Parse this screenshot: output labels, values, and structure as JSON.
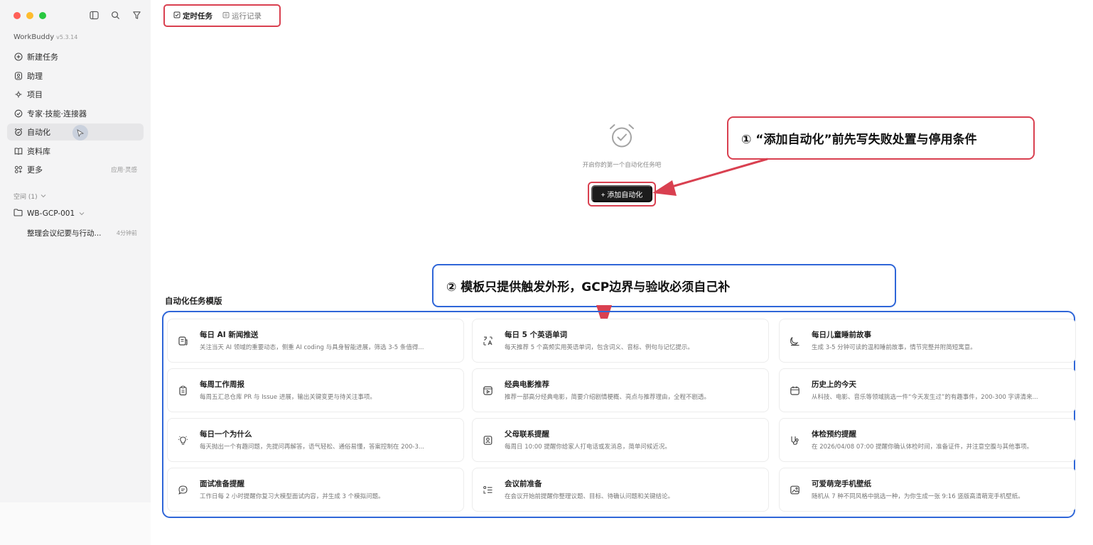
{
  "sidebar": {
    "app_name": "WorkBuddy",
    "version": "v5.3.14",
    "nav": [
      {
        "label": "新建任务",
        "icon": "plus-circle-icon"
      },
      {
        "label": "助理",
        "icon": "assistant-icon"
      },
      {
        "label": "项目",
        "icon": "project-icon"
      },
      {
        "label": "专家·技能·连接器",
        "icon": "expert-icon"
      },
      {
        "label": "自动化",
        "icon": "alarm-clock-icon",
        "active": true
      },
      {
        "label": "资料库",
        "icon": "book-icon"
      },
      {
        "label": "更多",
        "icon": "grid-icon",
        "right": "应用·灵感"
      }
    ],
    "space_label": "空间 (1)",
    "workspace": "WB-GCP-001",
    "task": {
      "label": "整理会议纪要与行动...",
      "time": "4分钟前"
    }
  },
  "tabs": [
    {
      "label": "定时任务",
      "icon": "checkbox-icon",
      "active": true
    },
    {
      "label": "运行记录",
      "icon": "history-icon",
      "active": false
    }
  ],
  "empty": {
    "text": "开启你的第一个自动化任务吧",
    "button": "+ 添加自动化"
  },
  "callouts": {
    "one": "① “添加自动化”前先写失败处置与停用条件",
    "two": "② 模板只提供触发外形，GCP边界与验收必须自己补"
  },
  "templates": {
    "title": "自动化任务模版",
    "items": [
      {
        "title": "每日 AI 新闻推送",
        "desc": "关注当天 AI 领域的重要动态，侧重 AI coding 与具身智能进展，筛选 3-5 条值得...",
        "icon": "news-icon"
      },
      {
        "title": "每日 5 个英语单词",
        "desc": "每天推荐 5 个高频实用英语单词，包含词义、音标、例句与记忆提示。",
        "icon": "translate-icon"
      },
      {
        "title": "每日儿童睡前故事",
        "desc": "生成 3-5 分钟可读的温和睡前故事，情节完整并附简短寓意。",
        "icon": "moon-icon"
      },
      {
        "title": "每周工作周报",
        "desc": "每周五汇总仓库 PR 与 Issue 进展，输出关键变更与待关注事项。",
        "icon": "clipboard-icon"
      },
      {
        "title": "经典电影推荐",
        "desc": "推荐一部高分经典电影，简要介绍剧情梗概、亮点与推荐理由，全程不剧透。",
        "icon": "film-icon"
      },
      {
        "title": "历史上的今天",
        "desc": "从科技、电影、音乐等领域挑选一件“今天发生过”的有趣事件，200-300 字讲清来...",
        "icon": "calendar-icon"
      },
      {
        "title": "每日一个为什么",
        "desc": "每天抛出一个有趣问题，先提问再解答，语气轻松、通俗易懂，答案控制在 200-3...",
        "icon": "bulb-icon"
      },
      {
        "title": "父母联系提醒",
        "desc": "每周日 10:00 提醒你给家人打电话或发消息，简单问候近况。",
        "icon": "contact-icon"
      },
      {
        "title": "体检预约提醒",
        "desc": "在 2026/04/08 07:00 提醒你确认体检时间，准备证件，并注意空腹与其他事项。",
        "icon": "health-icon"
      },
      {
        "title": "面试准备提醒",
        "desc": "工作日每 2 小时提醒你复习大模型面试内容，并生成 3 个模拟问题。",
        "icon": "chat-icon"
      },
      {
        "title": "会议前准备",
        "desc": "在会议开始前提醒你整理议题、目标、待确认问题和关键结论。",
        "icon": "list-icon"
      },
      {
        "title": "可爱萌宠手机壁纸",
        "desc": "随机从 7 种不同风格中挑选一种，为你生成一张 9:16 竖版高清萌宠手机壁纸。",
        "icon": "image-icon"
      }
    ]
  },
  "colors": {
    "accent_red": "#d94050",
    "accent_blue": "#2f66d8",
    "button_dark": "#1c1c1c"
  }
}
